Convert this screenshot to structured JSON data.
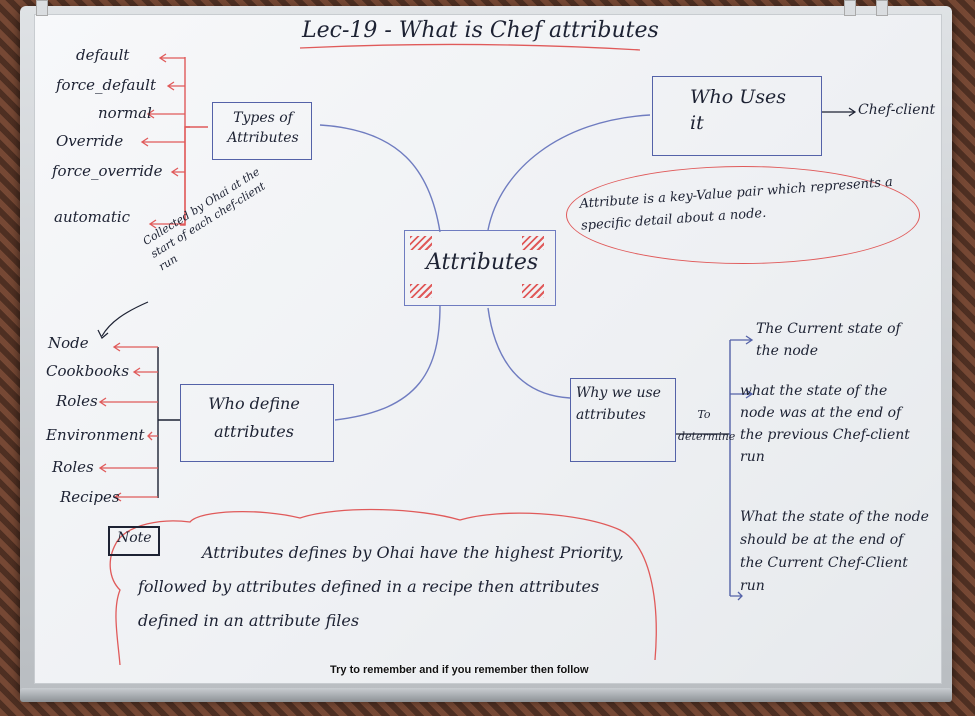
{
  "title": "Lec-19 - What is Chef attributes",
  "center": "Attributes",
  "types_box": "Types of Attributes",
  "types": [
    "default",
    "force_default",
    "normal",
    "Override",
    "force_override",
    "automatic"
  ],
  "who_uses": {
    "box": "Who Uses it",
    "answer": "Chef-client"
  },
  "definition": "Attribute is a key-Value pair which represents a specific detail about a node.",
  "ohai_note": "Collected by Ohai at the start of each chef-client run",
  "who_define": {
    "box": "Who define attributes",
    "sources": [
      "Node",
      "Cookbooks",
      "Roles",
      "Environment",
      "Roles",
      "Recipes"
    ]
  },
  "why_use": {
    "box": "Why we use attributes",
    "connector": "To determine",
    "reasons": [
      "The Current state of the node",
      "what the state of the node was at the end of the previous Chef-client run",
      "What the state of the node should be at the end of the Current Chef-Client run"
    ]
  },
  "note": {
    "label": "Note",
    "text": "Attributes defines by Ohai have the highest Priority, followed by attributes defined in a recipe then attributes defined in an attribute files"
  },
  "caption": "Try to remember and if you remember then follow"
}
